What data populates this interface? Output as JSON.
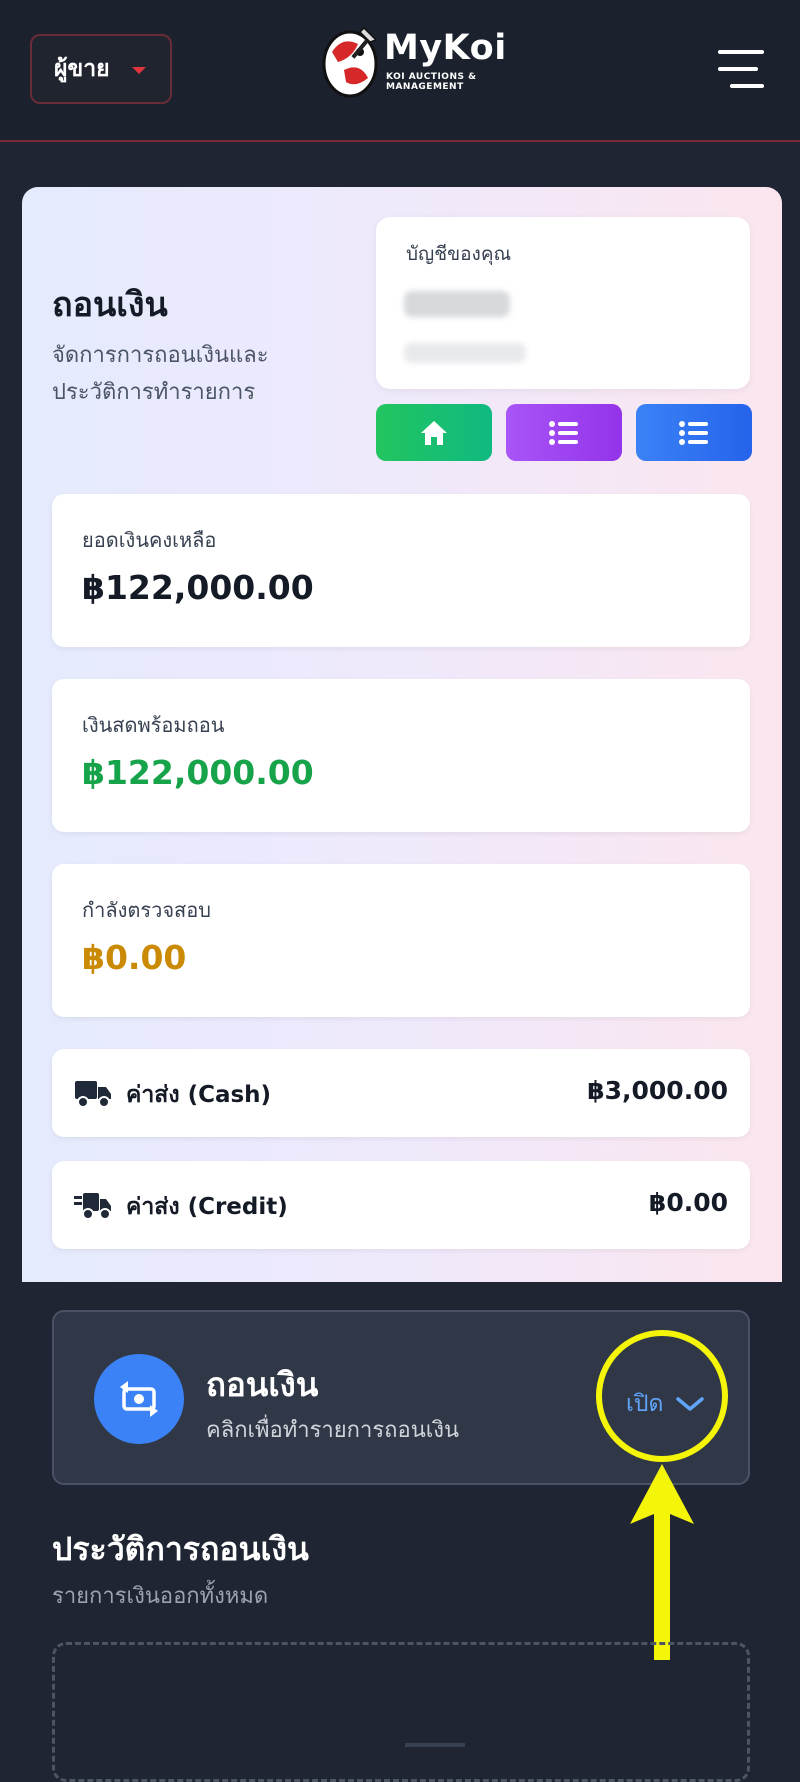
{
  "header": {
    "role_select": {
      "value": "ผู้ขาย"
    },
    "logo": {
      "name": "MyKoi",
      "tagline_line1": "KOI AUCTIONS &",
      "tagline_line2": "MANAGEMENT"
    },
    "menu_icon": "hamburger-icon"
  },
  "summary": {
    "title": "ถอนเงิน",
    "description": "จัดการการถอนเงินและประวัติการทำรายการ",
    "account_label": "บัญชีของคุณ",
    "quick_actions": [
      {
        "icon": "home-icon",
        "color": "#22c55e"
      },
      {
        "icon": "list-icon",
        "color": "#a855f7"
      },
      {
        "icon": "list-icon",
        "color": "#3b82f6"
      }
    ]
  },
  "stats": [
    {
      "label": "ยอดเงินคงเหลือ",
      "value": "฿122,000.00",
      "color": "#141a26"
    },
    {
      "label": "เงินสดพร้อมถอน",
      "value": "฿122,000.00",
      "color": "#16a34a"
    },
    {
      "label": "กำลังตรวจสอบ",
      "value": "฿0.00",
      "color": "#ca8a04"
    }
  ],
  "fees": [
    {
      "icon": "truck-icon",
      "label": "ค่าส่ง (Cash)",
      "value": "฿3,000.00"
    },
    {
      "icon": "fast-truck-icon",
      "label": "ค่าส่ง (Credit)",
      "value": "฿0.00"
    }
  ],
  "withdraw": {
    "icon": "money-transfer-icon",
    "title": "ถอนเงิน",
    "subtitle": "คลิกเพื่อทำรายการถอนเงิน",
    "toggle_label": "เปิด"
  },
  "history": {
    "title": "ประวัติการถอนเงิน",
    "subtitle": "รายการเงินออกทั้งหมด"
  },
  "colors": {
    "header_bg": "#1b212d",
    "accent_red": "#e0353f",
    "annotation_yellow": "#f5f50a",
    "link_blue": "#60a5fa"
  }
}
